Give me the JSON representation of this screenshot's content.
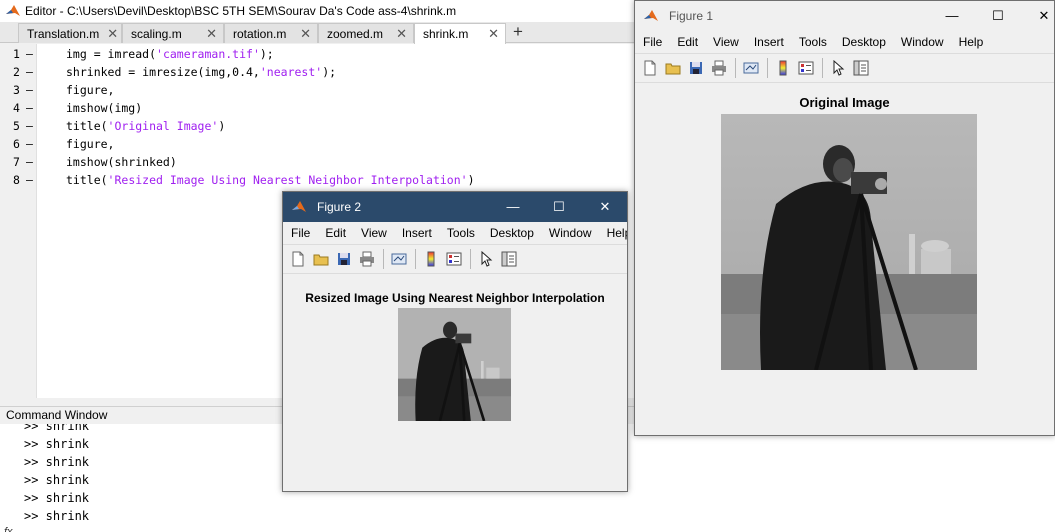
{
  "editor": {
    "title": "Editor - C:\\Users\\Devil\\Desktop\\BSC 5TH SEM\\Sourav Da's Code ass-4\\shrink.m",
    "tabs": [
      {
        "label": "Translation.m"
      },
      {
        "label": "scaling.m"
      },
      {
        "label": "rotation.m"
      },
      {
        "label": "zoomed.m"
      },
      {
        "label": "shrink.m",
        "active": true
      }
    ],
    "add_tab_icon": "plus-icon",
    "lines": [
      {
        "num": "1",
        "marker": "–",
        "pre": "img = imread(",
        "str": "'cameraman.tif'",
        "post": ");"
      },
      {
        "num": "2",
        "marker": "–",
        "pre": "shrinked = imresize(img,0.4,",
        "str": "'nearest'",
        "post": ");"
      },
      {
        "num": "3",
        "marker": "–",
        "pre": "figure,",
        "str": "",
        "post": ""
      },
      {
        "num": "4",
        "marker": "–",
        "pre": "imshow(img)",
        "str": "",
        "post": ""
      },
      {
        "num": "5",
        "marker": "–",
        "pre": "title(",
        "str": "'Original Image'",
        "post": ")"
      },
      {
        "num": "6",
        "marker": "–",
        "pre": "figure,",
        "str": "",
        "post": ""
      },
      {
        "num": "7",
        "marker": "–",
        "pre": "imshow(shrinked)",
        "str": "",
        "post": ""
      },
      {
        "num": "8",
        "marker": "–",
        "pre": "title(",
        "str": "'Resized Image Using Nearest Neighbor Interpolation'",
        "post": ")"
      }
    ]
  },
  "command_window": {
    "title": "Command Window",
    "lines": [
      ">> shrink",
      ">> shrink",
      ">> shrink",
      ">> shrink",
      ">> shrink",
      ">> shrink"
    ],
    "prompt_symbol": "fx"
  },
  "figure1": {
    "title": "Figure 1",
    "menu": [
      "File",
      "Edit",
      "View",
      "Insert",
      "Tools",
      "Desktop",
      "Window",
      "Help"
    ],
    "caption": "Original Image",
    "image": "cameraman-photo"
  },
  "figure2": {
    "title": "Figure 2",
    "menu": [
      "File",
      "Edit",
      "View",
      "Insert",
      "Tools",
      "Desktop",
      "Window",
      "Help"
    ],
    "caption": "Resized Image Using Nearest Neighbor Interpolation",
    "image": "cameraman-photo-small"
  },
  "toolbar_icons": [
    "new-figure-icon",
    "open-file-icon",
    "save-icon",
    "print-icon",
    "link-plot-icon",
    "insert-colorbar-icon",
    "insert-legend-icon",
    "edit-plot-icon",
    "property-inspector-icon"
  ],
  "colors": {
    "string": "#a020f0",
    "title_bar_active": "#ffffff",
    "figure_bg": "#f0f0f0"
  }
}
